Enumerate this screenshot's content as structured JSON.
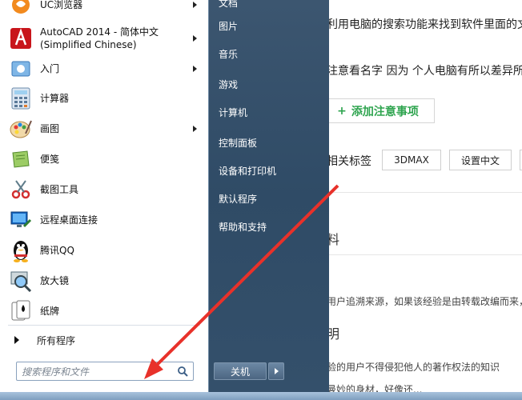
{
  "webpage": {
    "line1": "利用电脑的搜索功能来找到软件里面的文",
    "line2": "注意看名字 因为 个人电脑有所以差异所",
    "add_note": "添加注意事项",
    "add_note_plus": "+",
    "tags_label": "相关标签",
    "tags": [
      "3DMAX",
      "设置中文"
    ],
    "heading_ref": "参考资料",
    "ref_text": "用户追溯来源，如果该经验是由转载改编而来，",
    "heading_statement": "明",
    "statement_text": "验的用户不得侵犯他人的著作权法的知识",
    "bottom_text": "曼妙的身材，好像还..."
  },
  "start_menu": {
    "programs": [
      {
        "label": "UC浏览器",
        "icon": "uc-browser-icon",
        "has_submenu": true
      },
      {
        "label": "AutoCAD 2014 - 简体中文\n(Simplified Chinese)",
        "icon": "autocad-icon",
        "has_submenu": true
      },
      {
        "label": "入门",
        "icon": "getting-started-icon",
        "has_submenu": true
      },
      {
        "label": "计算器",
        "icon": "calculator-icon",
        "has_submenu": false
      },
      {
        "label": "画图",
        "icon": "paint-icon",
        "has_submenu": true
      },
      {
        "label": "便笺",
        "icon": "sticky-notes-icon",
        "has_submenu": false
      },
      {
        "label": "截图工具",
        "icon": "snipping-tool-icon",
        "has_submenu": false
      },
      {
        "label": "远程桌面连接",
        "icon": "remote-desktop-icon",
        "has_submenu": false
      },
      {
        "label": "腾讯QQ",
        "icon": "qq-penguin-icon",
        "has_submenu": false
      },
      {
        "label": "放大镜",
        "icon": "magnifier-icon",
        "has_submenu": false
      },
      {
        "label": "纸牌",
        "icon": "solitaire-icon",
        "has_submenu": false
      }
    ],
    "all_programs": "所有程序",
    "search_placeholder": "搜索程序和文件",
    "right_links": [
      "文档",
      "图片",
      "音乐",
      "游戏",
      "计算机",
      "控制面板",
      "设备和打印机",
      "默认程序",
      "帮助和支持"
    ],
    "shutdown": "关机"
  },
  "colors": {
    "right_pane": "#3c5670",
    "accent_green": "#2ea44f",
    "arrow_red": "#e8312a"
  }
}
